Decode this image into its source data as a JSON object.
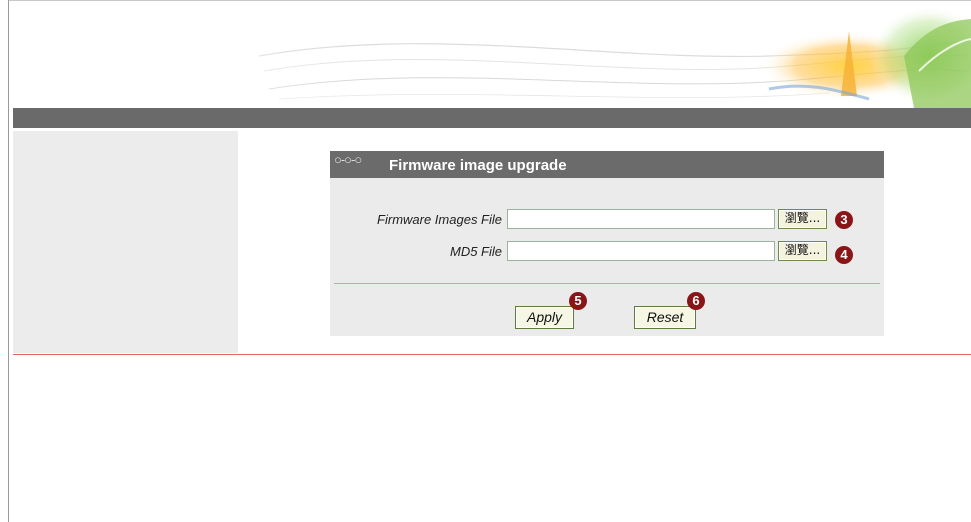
{
  "panel": {
    "rings_glyph": "○-○-○",
    "title": "Firmware image upgrade"
  },
  "form": {
    "firmware_label": "Firmware Images File",
    "firmware_value": "",
    "firmware_browse": "瀏覽...",
    "md5_label": "MD5 File",
    "md5_value": "",
    "md5_browse": "瀏覽...",
    "apply_label": "Apply",
    "reset_label": "Reset"
  },
  "badges": {
    "firmware_browse": "3",
    "md5_browse": "4",
    "apply": "5",
    "reset": "6"
  },
  "colors": {
    "nav_bar": "#6a6a6a",
    "panel_header": "#6b6b6b",
    "badge": "#8a1518",
    "divider": "#e8606a"
  }
}
